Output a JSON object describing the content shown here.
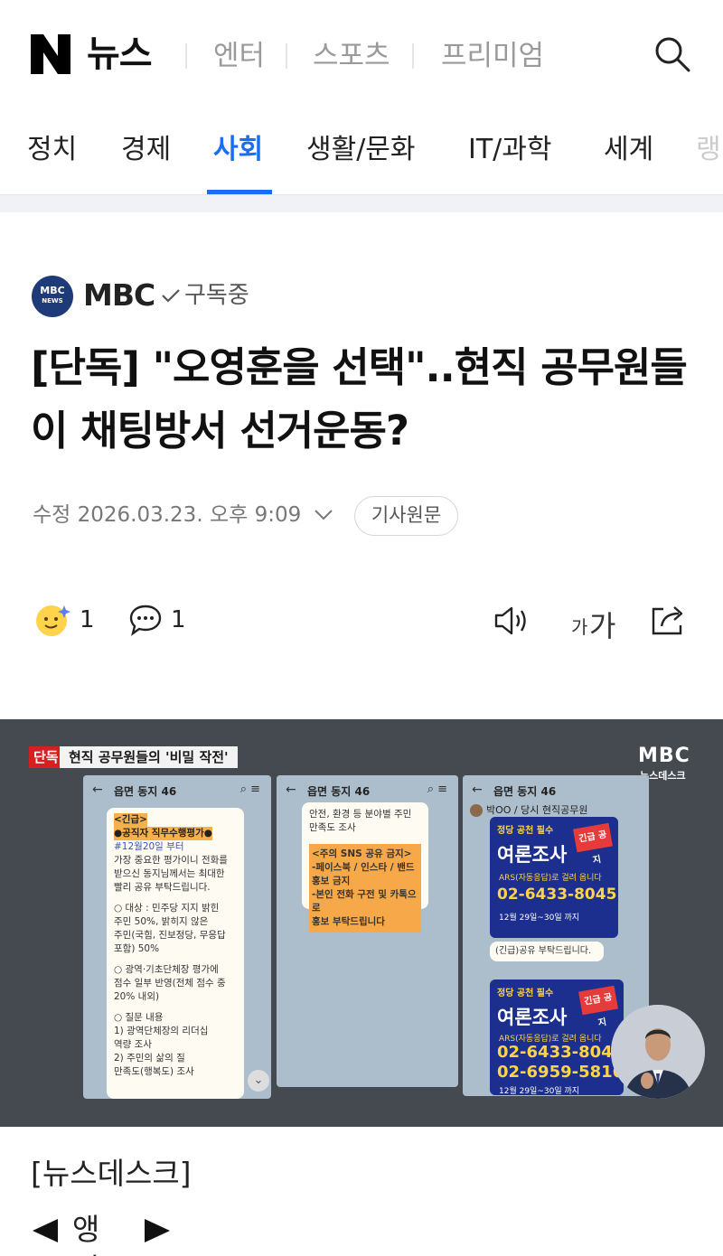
{
  "header": {
    "logo_letter": "N",
    "logo_text": "뉴스",
    "nav": [
      "엔터",
      "스포츠",
      "프리미엄"
    ]
  },
  "categories": {
    "items": [
      "정치",
      "경제",
      "사회",
      "생활/문화",
      "IT/과학",
      "세계",
      "랭"
    ],
    "active": "사회"
  },
  "article": {
    "press": "MBC",
    "press_logo_text": "MBC NEWS",
    "subscribe_label": "구독중",
    "title": "[단독] \"오영훈을 선택\"..현직 공무원들이 채팅방서 선거운동?",
    "meta": "수정 2026.03.23. 오후 9:09",
    "original_button": "기사원문",
    "reaction_count": "1",
    "comment_count": "1",
    "font_small": "가",
    "font_big": "가",
    "body_lines": [
      "[뉴스데스크]",
      "앵커"
    ]
  },
  "video": {
    "badge": "단독",
    "caption": "현직 공무원들의 '비밀 작전'",
    "logo": "MBC",
    "logo_sub": "뉴스데스크",
    "chat_title": "읍면 동지 46",
    "phone1_lines": [
      "<긴급>",
      "●공직자 직무수행평가●",
      "#12월20일 부터",
      "가장 중요한 평가이니 전화를",
      "받으신 동지님께서는 최대한",
      "빨리 공유 부탁드립니다.",
      "○ 대상 : 민주당 지지 밝힌",
      "주민 50%, 밝히지 않은",
      "주민(국힘, 진보정당, 무응답",
      "포함) 50%",
      "○ 광역·기초단체장 평가에",
      "점수 일부 반영(전체 점수 중",
      "20% 내외)",
      "○ 질문 내용",
      "1) 광역단체장의 리더십",
      "역량 조사",
      "2) 주민의 삶의 질",
      "만족도(행복도) 조사"
    ],
    "phone2_lines": [
      "안전, 환경 등 분야별 주민",
      "만족도 조사"
    ],
    "phone2_orange": [
      "<주의 SNS 공유 금지>",
      "-페이스북 / 인스타 / 밴드",
      "홍보 금지",
      "-본인 전화 구전 및 카톡으로",
      "홍보 부탁드립니다"
    ],
    "phone3_sender": "박OO / 당시 현직공무원",
    "poster_top": "정당 공천 필수",
    "poster_title": "여론조사",
    "poster_badge": "긴급 공지",
    "poster_num1": "02-6433-8045",
    "poster_num2": "02-6959-5816",
    "poster_ars": "ARS(자동응답)로 걸려 옵니다",
    "poster_date": "12월 29일~30일 까지",
    "phone3_bubble": "(긴급)공유 부탁드립니다."
  }
}
